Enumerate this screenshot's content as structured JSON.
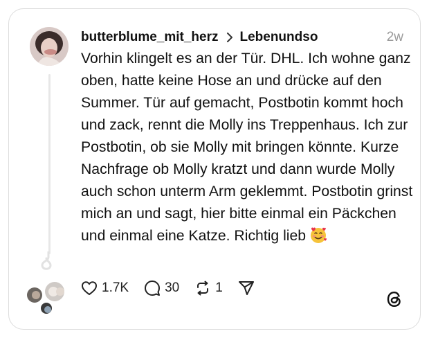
{
  "post": {
    "username": "butterblume_mit_herz",
    "community": "Lebenundso",
    "timestamp": "2w",
    "text": "Vorhin klingelt es an der Tür. DHL. Ich wohne ganz oben, hatte keine Hose an und drücke auf den Summer. Tür auf gemacht, Postbotin kommt hoch und zack, rennt die Molly ins Treppenhaus. Ich zur Postbotin, ob sie Molly mit bringen könnte. Kurze Nachfrage ob Molly kratzt und dann wurde Molly auch schon unterm Arm geklemmt. Postbotin grinst mich an und sagt, hier bitte einmal ein Päckchen und einmal eine Katze. Richtig lieb",
    "emoji": "smiling-face-with-hearts"
  },
  "actions": {
    "likes": "1.7K",
    "comments": "30",
    "reposts": "1"
  },
  "icons": {
    "like": "heart-icon",
    "comment": "comment-icon",
    "repost": "repost-icon",
    "share": "share-icon",
    "brand": "threads-logo-icon",
    "separator": "chevron-right-icon"
  },
  "colors": {
    "text": "#111111",
    "muted": "#9a9a9a",
    "border": "#dcdcdc",
    "thread_line": "#e7e7e7"
  }
}
